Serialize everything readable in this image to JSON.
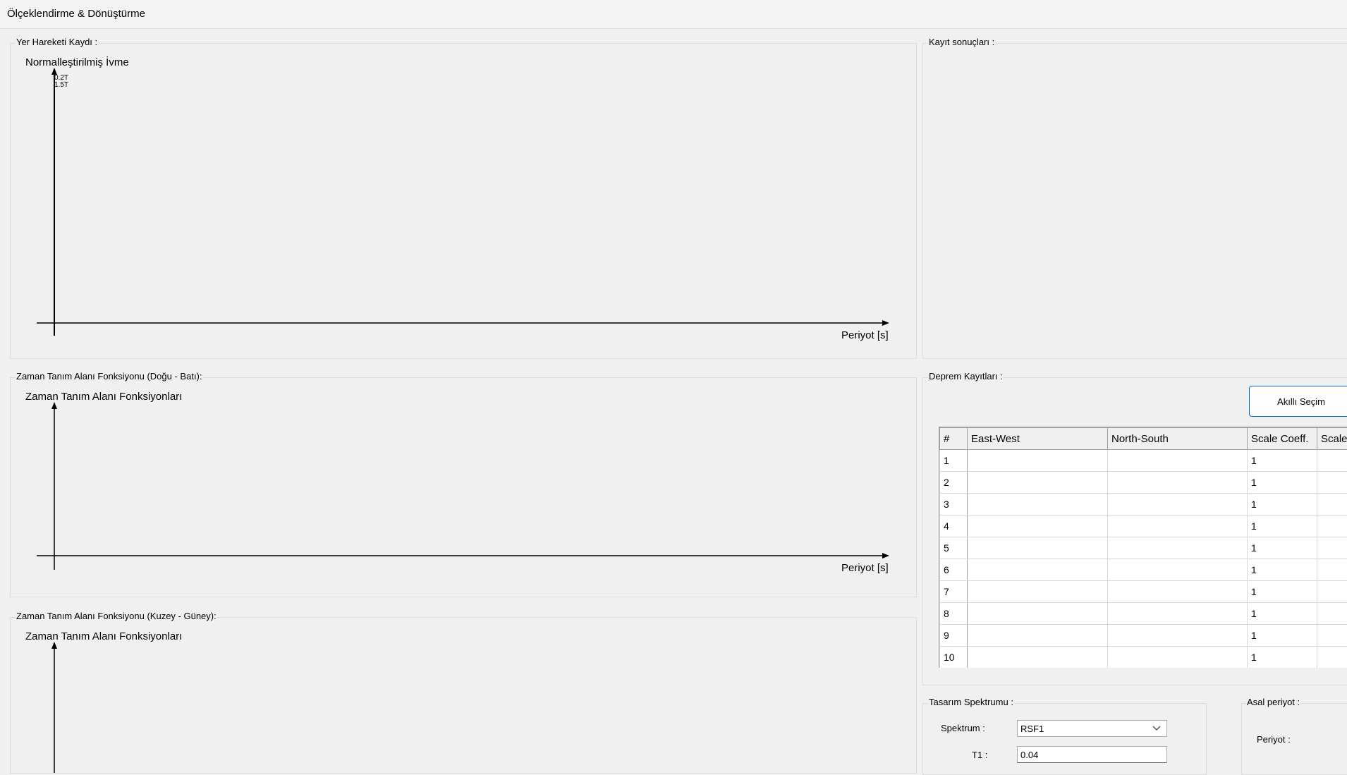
{
  "window": {
    "title": "Ölçeklendirme & Dönüştürme"
  },
  "ground_motion": {
    "group_label": "Yer Hareketi Kaydı :",
    "chart": {
      "title": "Normalleştirilmiş İvme",
      "xlabel": "Periyot [s]",
      "tick_labels": [
        "0.2T",
        "1.5T"
      ]
    }
  },
  "time_domain_ew": {
    "group_label": "Zaman Tanım Alanı Fonksiyonu (Doğu - Batı):",
    "chart": {
      "title": "Zaman Tanım Alanı Fonksiyonları",
      "xlabel": "Periyot [s]"
    }
  },
  "time_domain_ns": {
    "group_label": "Zaman Tanım Alanı Fonksiyonu (Kuzey - Güney):",
    "chart": {
      "title": "Zaman Tanım Alanı Fonksiyonları"
    }
  },
  "record_results": {
    "group_label": "Kayıt sonuçları :"
  },
  "earthquake_records": {
    "group_label": "Deprem Kayıtları :",
    "smart_select_label": "Akıllı Seçim",
    "columns": [
      "#",
      "East-West",
      "North-South",
      "Scale Coeff.",
      "Scale"
    ],
    "rows": [
      {
        "idx": "1",
        "ew": "",
        "ns": "",
        "coeff": "1",
        "scale": ""
      },
      {
        "idx": "2",
        "ew": "",
        "ns": "",
        "coeff": "1",
        "scale": ""
      },
      {
        "idx": "3",
        "ew": "",
        "ns": "",
        "coeff": "1",
        "scale": ""
      },
      {
        "idx": "4",
        "ew": "",
        "ns": "",
        "coeff": "1",
        "scale": ""
      },
      {
        "idx": "5",
        "ew": "",
        "ns": "",
        "coeff": "1",
        "scale": ""
      },
      {
        "idx": "6",
        "ew": "",
        "ns": "",
        "coeff": "1",
        "scale": ""
      },
      {
        "idx": "7",
        "ew": "",
        "ns": "",
        "coeff": "1",
        "scale": ""
      },
      {
        "idx": "8",
        "ew": "",
        "ns": "",
        "coeff": "1",
        "scale": ""
      },
      {
        "idx": "9",
        "ew": "",
        "ns": "",
        "coeff": "1",
        "scale": ""
      },
      {
        "idx": "10",
        "ew": "",
        "ns": "",
        "coeff": "1",
        "scale": ""
      }
    ]
  },
  "design_spectrum": {
    "group_label": "Tasarım Spektrumu :",
    "spectrum_label": "Spektrum :",
    "spectrum_value": "RSF1",
    "t1_label": "T1 :",
    "t1_value": "0.04"
  },
  "principal_period": {
    "group_label": "Asal periyot :",
    "period_label": "Periyot :"
  },
  "colors": {
    "accent": "#0067c0",
    "background": "#f0f0f0"
  }
}
